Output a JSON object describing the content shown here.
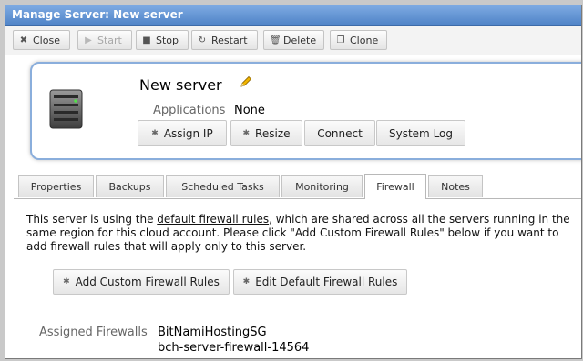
{
  "window": {
    "title": "Manage Server: New server"
  },
  "toolbar": {
    "close": "Close",
    "start": "Start",
    "stop": "Stop",
    "restart": "Restart",
    "delete": "Delete",
    "clone": "Clone"
  },
  "server": {
    "name": "New server",
    "applications_label": "Applications",
    "applications_value": "None",
    "actions": {
      "assign_ip": "Assign IP",
      "resize": "Resize",
      "connect": "Connect",
      "system_log": "System Log"
    }
  },
  "tabs": [
    "Properties",
    "Backups",
    "Scheduled Tasks",
    "Monitoring",
    "Firewall",
    "Notes"
  ],
  "active_tab": "Firewall",
  "firewall": {
    "desc_before": "This server is using the ",
    "desc_link": "default firewall rules",
    "desc_after": ", which are shared across all the servers running in the same region for this cloud account. Please click \"Add Custom Firewall Rules\" below if you want to add firewall rules that will apply only to this server.",
    "add_custom": "Add Custom Firewall Rules",
    "edit_default": "Edit Default Firewall Rules",
    "assigned_label": "Assigned Firewalls",
    "assigned": [
      "BitNamiHostingSG",
      "bch-server-firewall-14564"
    ]
  },
  "colors": {
    "title_bar": "#5a8fd0",
    "card_border": "#8aaedc",
    "pencil": "#e8a600"
  }
}
